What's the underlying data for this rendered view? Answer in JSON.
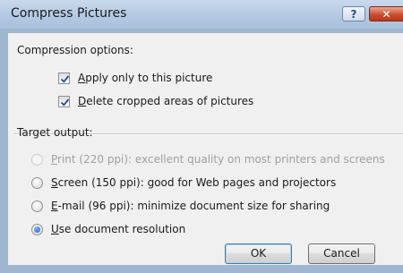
{
  "window": {
    "title": "Compress Pictures",
    "help_glyph": "?",
    "close_glyph": "✕"
  },
  "compression": {
    "heading": "Compression options:",
    "options": [
      {
        "mnemonic": "A",
        "rest": "pply only to this picture",
        "checked": true
      },
      {
        "mnemonic": "D",
        "rest": "elete cropped areas of pictures",
        "checked": true
      }
    ]
  },
  "target": {
    "heading": "Target output:",
    "options": [
      {
        "mnemonic": "P",
        "rest": "rint (220 ppi): excellent quality on most printers and screens",
        "selected": false,
        "disabled": true
      },
      {
        "mnemonic": "S",
        "rest": "creen (150 ppi): good for Web pages and projectors",
        "selected": false,
        "disabled": false
      },
      {
        "mnemonic": "E",
        "rest": "-mail (96 ppi): minimize document size for sharing",
        "selected": false,
        "disabled": false
      },
      {
        "mnemonic": "U",
        "rest": "se document resolution",
        "selected": true,
        "disabled": false
      }
    ]
  },
  "buttons": {
    "ok": "OK",
    "cancel": "Cancel"
  },
  "colors": {
    "frame": "#9eb6cf",
    "client": "#f0f0f0",
    "radio_selected": "#1c5ec7",
    "checkmark": "#1f4f9a"
  }
}
